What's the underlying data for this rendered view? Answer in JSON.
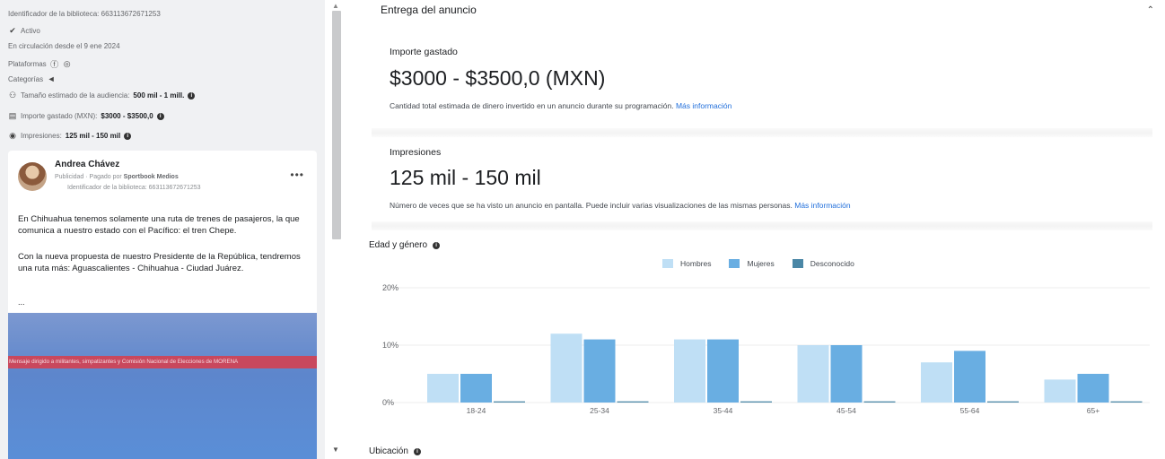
{
  "left": {
    "library_id": "Identificador de la biblioteca: 663113672671253",
    "status": "Activo",
    "running_since": "En circulación desde el 9 ene 2024",
    "platforms_label": "Plataformas",
    "categories_label": "Categorías",
    "audience_label": "Tamaño estimado de la audiencia:",
    "audience_value": "500 mil - 1 mill.",
    "spend_label": "Importe gastado (MXN):",
    "spend_value": "$3000 - $3500,0",
    "impressions_label": "Impresiones:",
    "impressions_value": "125 mil - 150 mil",
    "ad": {
      "advertiser": "Andrea Chávez",
      "sponsored": "Publicidad · Pagado por",
      "payer": "Sportbook Medios",
      "library_id": "Identificador de la biblioteca: 663113672671253",
      "paragraph1": "En Chihuahua tenemos solamente una ruta de trenes de pasajeros, la que comunica a nuestro estado con el Pacífico: el tren Chepe.",
      "paragraph2": "Con la nueva propuesta de nuestro Presidente de la República, tendremos una ruta más: Aguascalientes - Chihuahua - Ciudad Juárez.",
      "more": "...",
      "banner": "Mensaje dirigido a militantes, simpatizantes y Comisión Nacional de Elecciones de MORENA"
    }
  },
  "right": {
    "section_title": "Entrega del anuncio",
    "spend_title": "Importe gastado",
    "spend_value": "$3000 - $3500,0 (MXN)",
    "spend_desc": "Cantidad total estimada de dinero invertido en un anuncio durante su programación.",
    "spend_link": "Más información",
    "impr_title": "Impresiones",
    "impr_value": "125 mil - 150 mil",
    "impr_desc": "Número de veces que se ha visto un anuncio en pantalla. Puede incluir varias visualizaciones de las mismas personas.",
    "impr_link": "Más información",
    "chart_title": "Edad y género",
    "location_title": "Ubicación"
  },
  "chart_data": {
    "type": "bar",
    "categories": [
      "18-24",
      "25-34",
      "35-44",
      "45-54",
      "55-64",
      "65+"
    ],
    "series": [
      {
        "name": "Hombres",
        "color": "#bfdff5",
        "values": [
          5,
          12,
          11,
          10,
          7,
          4
        ]
      },
      {
        "name": "Mujeres",
        "color": "#69aee2",
        "values": [
          5,
          11,
          11,
          10,
          9,
          5
        ]
      },
      {
        "name": "Desconocido",
        "color": "#4a87a6",
        "values": [
          0.2,
          0.2,
          0.2,
          0.2,
          0.2,
          0.2
        ]
      }
    ],
    "y_ticks": [
      "20%",
      "10%",
      "0%"
    ],
    "ylim": [
      0,
      20
    ]
  }
}
